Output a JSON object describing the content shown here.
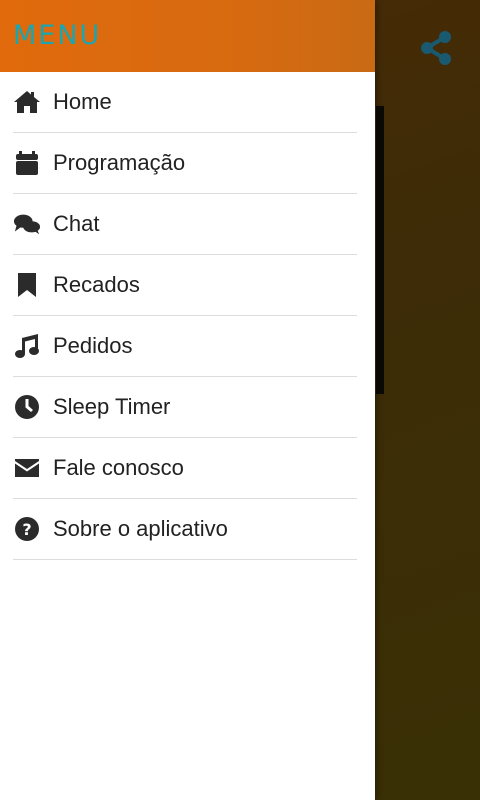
{
  "drawer": {
    "title": "MENU",
    "items": [
      {
        "label": "Home",
        "icon": "home-icon"
      },
      {
        "label": "Programação",
        "icon": "calendar-icon"
      },
      {
        "label": "Chat",
        "icon": "chat-icon"
      },
      {
        "label": "Recados",
        "icon": "bookmark-icon"
      },
      {
        "label": "Pedidos",
        "icon": "music-note-icon"
      },
      {
        "label": "Sleep Timer",
        "icon": "clock-icon"
      },
      {
        "label": "Fale conosco",
        "icon": "envelope-icon"
      },
      {
        "label": "Sobre o aplicativo",
        "icon": "question-circle-icon"
      }
    ]
  },
  "colors": {
    "header": "#e06a0c",
    "title": "#1aa6b0",
    "share_icon": "#1a5a70"
  },
  "background": {
    "share_icon": "share-icon"
  }
}
